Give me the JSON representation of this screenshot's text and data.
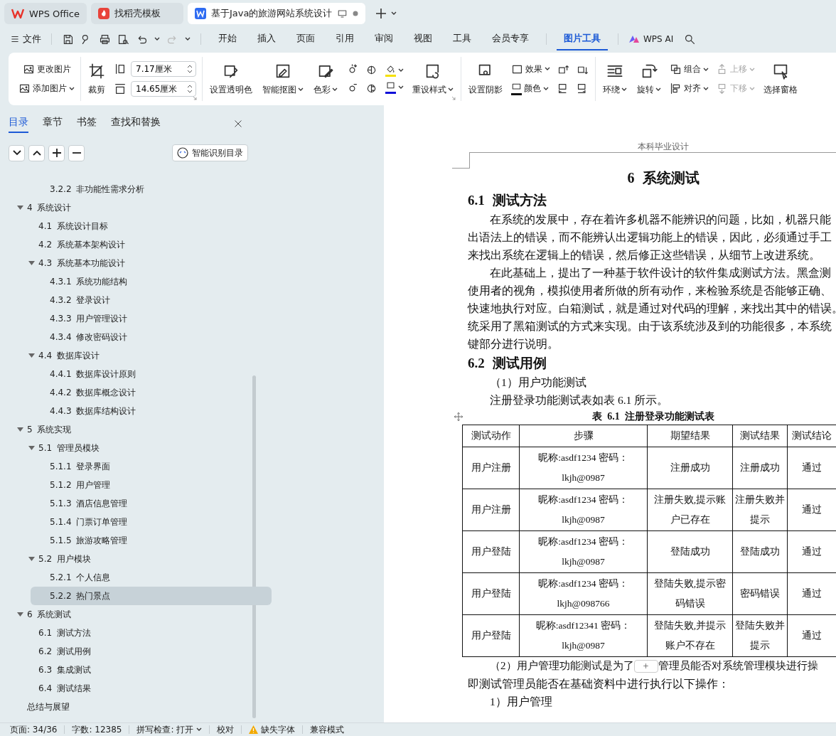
{
  "tabs": [
    {
      "label": "WPS Office",
      "kind": "home",
      "selected": false
    },
    {
      "label": "找稻壳模板",
      "kind": "template",
      "selected": false
    },
    {
      "label": "基于Java的旅游网站系统设计",
      "kind": "document",
      "selected": true
    }
  ],
  "menu": {
    "file": "文件",
    "tabs": [
      {
        "label": "开始",
        "selected": false
      },
      {
        "label": "插入",
        "selected": false
      },
      {
        "label": "页面",
        "selected": false
      },
      {
        "label": "引用",
        "selected": false
      },
      {
        "label": "审阅",
        "selected": false
      },
      {
        "label": "视图",
        "selected": false
      },
      {
        "label": "工具",
        "selected": false
      },
      {
        "label": "会员专享",
        "selected": false
      },
      {
        "label": "图片工具",
        "selected": true
      }
    ],
    "ai": "WPS AI"
  },
  "ribbon": {
    "change_picture": "更改图片",
    "add_picture": "添加图片",
    "crop": "裁剪",
    "width": "7.17厘米",
    "height": "14.65厘米",
    "set_transparent": "设置透明色",
    "smart_cutout": "智能抠图",
    "color_mode": "色彩",
    "reset_style": "重设样式",
    "shadow": "设置阴影",
    "effects": "效果",
    "shape_fill": "颜色",
    "wrap": "环绕",
    "rotate": "旋转",
    "group": "组合",
    "align": "对齐",
    "bring_forward": {
      "label": "上移",
      "disabled": true
    },
    "send_backward": {
      "label": "下移",
      "disabled": true
    },
    "selection_pane": "选择窗格"
  },
  "sidebar": {
    "tabs": [
      {
        "label": "目录",
        "selected": true
      },
      {
        "label": "章节",
        "selected": false
      },
      {
        "label": "书签",
        "selected": false
      },
      {
        "label": "查找和替换",
        "selected": false
      }
    ],
    "smart_toc": "智能识别目录",
    "toc": [
      {
        "children": [
          {
            "children": [
              {
                "label": "3.2.2 非功能性需求分析",
                "selected": false
              }
            ]
          }
        ]
      },
      {
        "label": "4 系统设计",
        "expanded": true,
        "selected": false,
        "children": [
          {
            "label": "4.1 系统设计目标",
            "selected": false
          },
          {
            "label": "4.2 系统基本架构设计",
            "selected": false
          },
          {
            "label": "4.3 系统基本功能设计",
            "expanded": true,
            "selected": false,
            "children": [
              {
                "label": "4.3.1 系统功能结构",
                "selected": false
              },
              {
                "label": "4.3.2 登录设计",
                "selected": false
              },
              {
                "label": "4.3.3 用户管理设计",
                "selected": false
              },
              {
                "label": "4.3.4 修改密码设计",
                "selected": false
              }
            ]
          },
          {
            "label": "4.4 数据库设计",
            "expanded": true,
            "selected": false,
            "children": [
              {
                "label": "4.4.1 数据库设计原则",
                "selected": false
              },
              {
                "label": "4.4.2 数据库概念设计",
                "selected": false
              },
              {
                "label": "4.4.3 数据库结构设计",
                "selected": false
              }
            ]
          }
        ]
      },
      {
        "label": "5 系统实现",
        "expanded": true,
        "selected": false,
        "children": [
          {
            "label": "5.1 管理员模块",
            "expanded": true,
            "selected": false,
            "children": [
              {
                "label": "5.1.1 登录界面",
                "selected": false
              },
              {
                "label": "5.1.2 用户管理",
                "selected": false
              },
              {
                "label": "5.1.3 酒店信息管理",
                "selected": false
              },
              {
                "label": "5.1.4 门票订单管理",
                "selected": false
              },
              {
                "label": "5.1.5 旅游攻略管理",
                "selected": false
              }
            ]
          },
          {
            "label": "5.2 用户模块",
            "expanded": true,
            "selected": false,
            "children": [
              {
                "label": "5.2.1 个人信息",
                "selected": false
              },
              {
                "label": "5.2.2 热门景点",
                "selected": true
              }
            ]
          }
        ]
      },
      {
        "label": "6 系统测试",
        "expanded": true,
        "selected": false,
        "children": [
          {
            "label": "6.1 测试方法",
            "selected": false
          },
          {
            "label": "6.2 测试用例",
            "selected": false
          },
          {
            "label": "6.3 集成测试",
            "selected": false
          },
          {
            "label": "6.4 测试结果",
            "selected": false
          }
        ]
      },
      {
        "label": "总结与展望",
        "selected": false
      }
    ]
  },
  "document": {
    "header": "本科毕业设计",
    "blocks": [
      {
        "kind": "title",
        "text": "6 系统测试"
      },
      {
        "kind": "heading",
        "text": "6.1 测试方法"
      },
      {
        "kind": "paragraph",
        "lines": [
          "在系统的发展中，存在着许多机器不能辨识的问题，比如，机器只能",
          "出语法上的错误，而不能辨认出逻辑功能上的错误，因此，必须通过手工",
          "来找出系统在逻辑上的错误，然后修正这些错误，从细节上改进系统。"
        ]
      },
      {
        "kind": "paragraph",
        "lines": [
          "在此基础上，提出了一种基于软件设计的软件集成测试方法。黑盒测",
          "使用者的视角，模拟使用者所做的所有动作，来检验系统是否能够正确、",
          "快速地执行对应。白箱测试，就是通过对代码的理解，来找出其中的错误。",
          "统采用了黑箱测试的方式来实现。由于该系统涉及到的功能很多，本系统",
          "键部分进行说明。"
        ]
      },
      {
        "kind": "heading",
        "text": "6.2 测试用例"
      },
      {
        "kind": "paragraph",
        "lines": [
          "（1）用户功能测试"
        ]
      },
      {
        "kind": "paragraph",
        "lines": [
          "注册登录功能测试表如表 6.1 所示。"
        ]
      },
      {
        "kind": "table",
        "caption": "表 6.1 注册登录功能测试表",
        "columns": [
          "测试动作",
          "步骤",
          "期望结果",
          "测试结果",
          "测试结论"
        ],
        "rows": [
          [
            "用户注册",
            "昵称:asdf1234 密码：lkjh@0987",
            "注册成功",
            "注册成功",
            "通过"
          ],
          [
            "用户注册",
            "昵称:asdf1234 密码：lkjh@0987",
            "注册失败,提示账户已存在",
            "注册失败并提示",
            "通过"
          ],
          [
            "用户登陆",
            "昵称:asdf1234 密码：lkjh@0987",
            "登陆成功",
            "登陆成功",
            "通过"
          ],
          [
            "用户登陆",
            "昵称:asdf1234 密码：lkjh@098766",
            "登陆失败,提示密码错误",
            "密码错误",
            "通过"
          ],
          [
            "用户登陆",
            "昵称:asdf12341 密码：lkjh@0987",
            "登陆失败,并提示账户不存在",
            "登陆失败并提示",
            "通过"
          ]
        ]
      },
      {
        "kind": "split_paragraph",
        "before": "（2）用户管理功能测试是为了",
        "insert": "+",
        "after": "管理员能否对系统管理模块进行操",
        "lines": [
          "即测试管理员能否在基础资料中进行执行以下操作："
        ]
      },
      {
        "kind": "paragraph",
        "lines": [
          "1）用户管理"
        ]
      }
    ]
  },
  "status_bar": {
    "page": "页面: 34/36",
    "words": "字数: 12385",
    "spell": "拼写检查: 打开",
    "proof": "校对",
    "missing_font": "缺失字体",
    "compat": "兼容模式"
  }
}
